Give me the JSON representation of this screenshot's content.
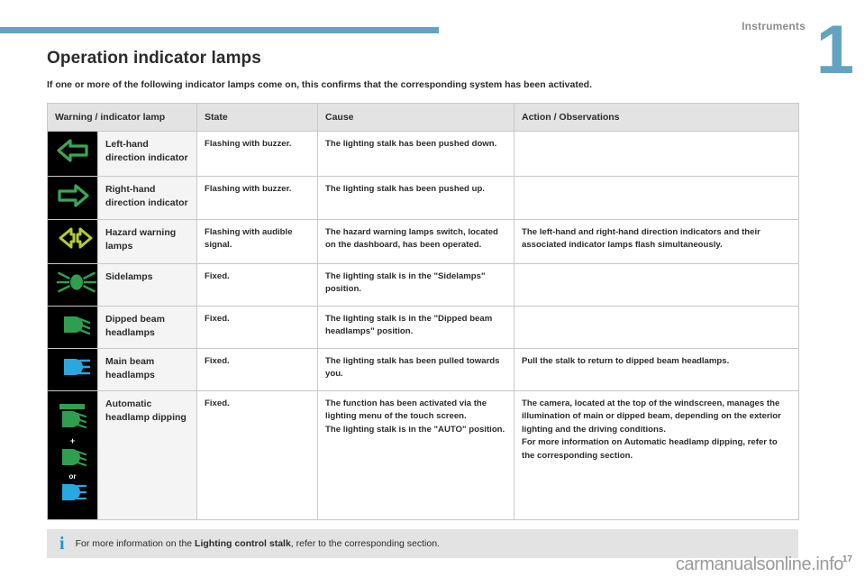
{
  "chapter": {
    "number": "1",
    "label": "Instruments"
  },
  "page": {
    "title": "Operation indicator lamps",
    "intro": "If one or more of the following indicator lamps come on, this confirms that the corresponding system has been activated.",
    "number": "17",
    "watermark": "carmanualsonline.info"
  },
  "table": {
    "headers": [
      "Warning / indicator lamp",
      "State",
      "Cause",
      "Action / Observations"
    ],
    "rows": [
      {
        "icon": "left-direction-arrow-icon",
        "name": "Left-hand direction indicator",
        "state": "Flashing with buzzer.",
        "cause": "The lighting stalk has been pushed down.",
        "action": ""
      },
      {
        "icon": "right-direction-arrow-icon",
        "name": "Right-hand direction indicator",
        "state": "Flashing with buzzer.",
        "cause": "The lighting stalk has been pushed up.",
        "action": ""
      },
      {
        "icon": "hazard-warning-icon",
        "name": "Hazard warning lamps",
        "state": "Flashing with audible signal.",
        "cause": "The hazard warning lamps switch, located on the dashboard, has been operated.",
        "action": "The left-hand and right-hand direction indicators and their associated indicator lamps flash simultaneously."
      },
      {
        "icon": "sidelamps-icon",
        "name": "Sidelamps",
        "state": "Fixed.",
        "cause": "The lighting stalk is in the \"Sidelamps\" position.",
        "action": ""
      },
      {
        "icon": "dipped-beam-icon",
        "name": "Dipped beam headlamps",
        "state": "Fixed.",
        "cause": "The lighting stalk is in the \"Dipped beam headlamps\" position.",
        "action": ""
      },
      {
        "icon": "main-beam-icon",
        "name": "Main beam headlamps",
        "state": "Fixed.",
        "cause": "The lighting stalk has been pulled towards you.",
        "action": "Pull the stalk to return to dipped beam headlamps."
      },
      {
        "icon": "automatic-headlamp-dipping-icon",
        "name": "Automatic headlamp dipping",
        "state": "Fixed.",
        "cause_lines": [
          "The function has been activated via the lighting menu of the touch screen.",
          "The lighting stalk is in the \"AUTO\" position."
        ],
        "action_lines": [
          "The camera, located at the top of the windscreen, manages the illumination of main or dipped beam, depending on the exterior lighting and the driving conditions.",
          "For more information on Automatic headlamp dipping, refer to the corresponding section."
        ]
      }
    ]
  },
  "note": {
    "icon": "info-icon",
    "prefix": "For more information on the ",
    "bold": "Lighting control stalk",
    "suffix": ", refer to the corresponding section."
  },
  "colors": {
    "accent": "#63a2c2",
    "green": "#3aa655",
    "lime": "#b2cc33",
    "blue": "#29a8df",
    "info_blue": "#2196c4",
    "header_grey": "#e3e3e3"
  }
}
